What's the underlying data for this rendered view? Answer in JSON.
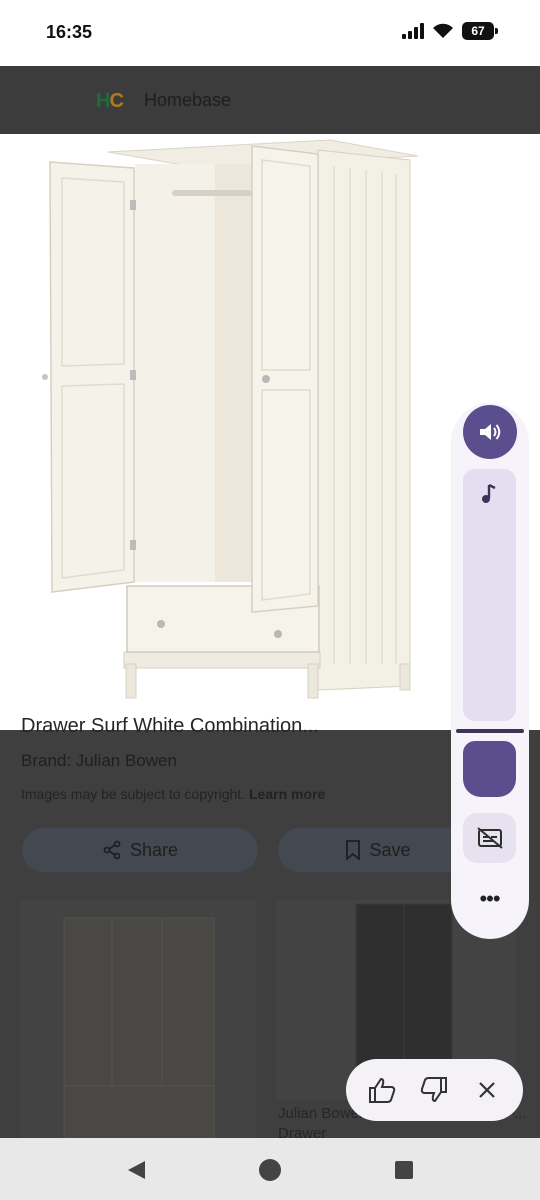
{
  "status_bar": {
    "time": "16:35",
    "battery": "67",
    "icons": [
      "signal-icon",
      "wifi-icon",
      "battery-icon"
    ]
  },
  "site": {
    "logo_h": "H",
    "logo_c": "C",
    "name": "Homebase"
  },
  "product": {
    "image_alt": "white two-door wardrobe with drawer",
    "title_partial": "Drawer Surf White Combination...",
    "brand": "Brand: Julian Bowen",
    "copyright_text": "Images may be subject to copyright.",
    "learn_more": "Learn more",
    "share_label": "Share",
    "save_label": "Save"
  },
  "related": {
    "caption": "Julian Bowen Stylish Maine 2 Door ... Drawer"
  },
  "media_panel": {
    "icons": [
      "volume-icon",
      "music-note-icon",
      "captions-off-icon",
      "more-icon"
    ],
    "volume_level": 0.12,
    "accent": "#5b4e8e",
    "more_label": "•••"
  },
  "feedback": {
    "icons": [
      "thumbs-up-icon",
      "thumbs-down-icon",
      "close-icon"
    ],
    "close_label": "✕"
  },
  "nav": {
    "icons": [
      "back-icon",
      "home-icon",
      "recents-icon"
    ]
  }
}
